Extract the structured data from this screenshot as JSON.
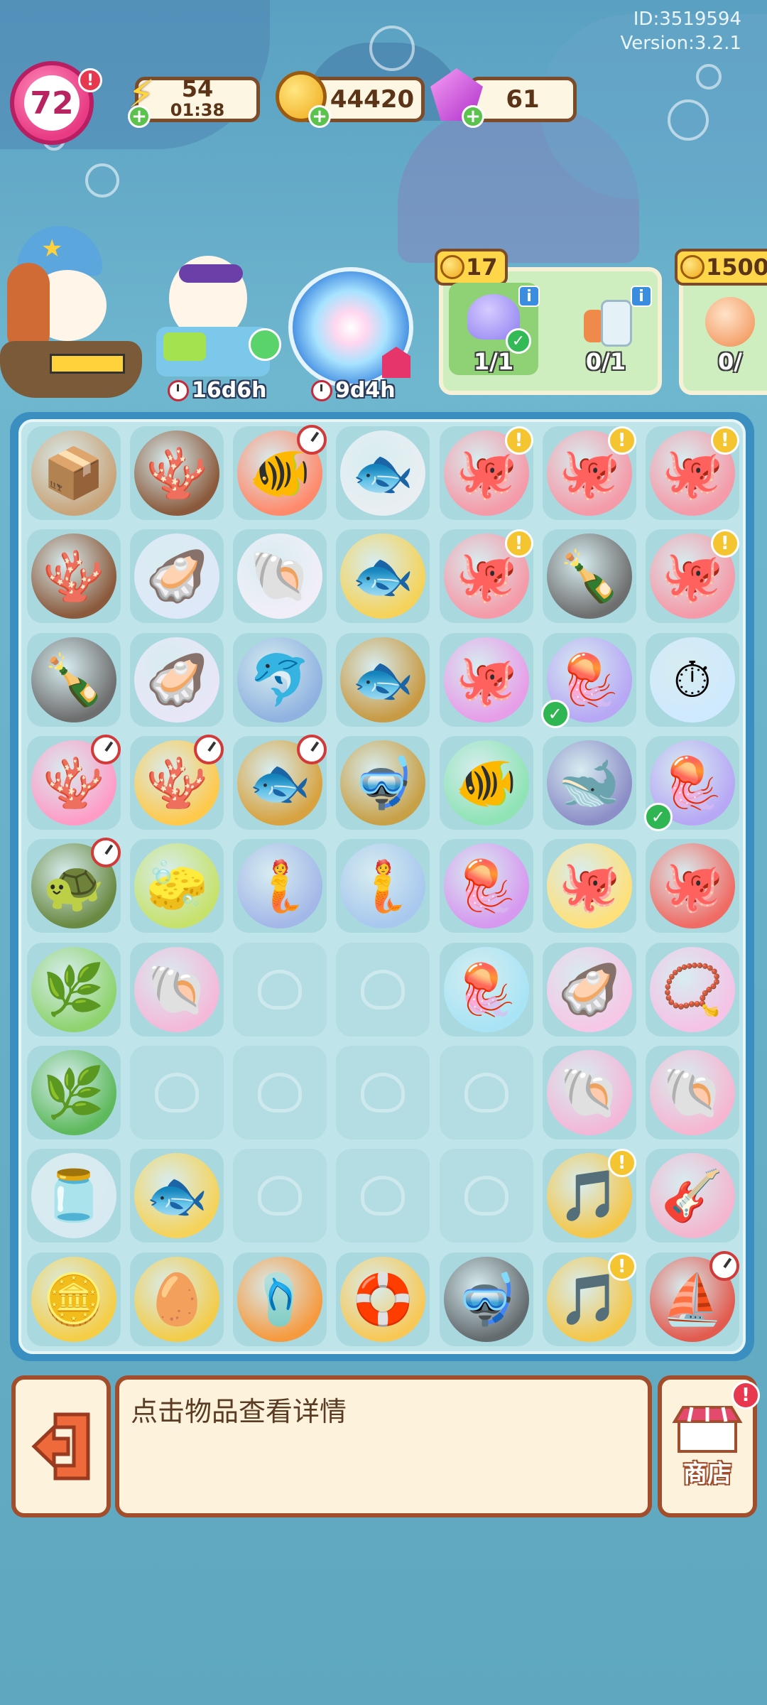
{
  "app_info": {
    "id_text": "ID:3519594",
    "version_text": "Version:3.2.1"
  },
  "player": {
    "level": "72"
  },
  "resources": {
    "energy": {
      "value": "54",
      "timer": "01:38",
      "icon": "lightning-icon"
    },
    "coins": {
      "value": "44420",
      "icon": "coin-icon"
    },
    "gems": {
      "value": "61",
      "icon": "gem-icon"
    }
  },
  "characters": [
    {
      "name": "captain-duck",
      "timer": ""
    },
    {
      "name": "sunglasses-duck",
      "timer": "16d6h"
    },
    {
      "name": "whirlpool-event",
      "timer": "9d4h"
    }
  ],
  "orders": [
    {
      "cost": "17",
      "requirements": [
        {
          "icon": "jellyfish-icon",
          "progress": "1/1",
          "done": true
        },
        {
          "icon": "bottle-coral-icon",
          "progress": "0/1",
          "done": false
        }
      ]
    },
    {
      "cost": "1500",
      "requirements": [
        {
          "icon": "mermaid-icon",
          "progress": "0/",
          "done": false
        }
      ]
    }
  ],
  "board": {
    "rows": [
      [
        "cardboard-box",
        "web-coral",
        "orange-fish-coral",
        "fish-skeleton",
        "octopus-musician",
        "octopus-musician",
        "octopus-musician"
      ],
      [
        "web-coral",
        "oyster-shell",
        "scallop-shell",
        "golden-fish-skeleton",
        "octopus-musician",
        "web-bottle",
        "octopus-musician"
      ],
      [
        "web-bottle",
        "pearl-shells",
        "dolphin",
        "bronze-fish",
        "purple-octopus",
        "jellyfish",
        "stopwatch"
      ],
      [
        "pink-coral",
        "coral-tree-worm",
        "mechanical-fish",
        "bronze-diving-helmet",
        "duck-tropical-fish",
        "captain-manta",
        "jellyfish"
      ],
      [
        "turtle-house",
        "sponge-coral",
        "mermaid-fish-heart",
        "mermaid-fish",
        "purple-jellyfish",
        "octopus-musician-glow",
        "red-octopus"
      ],
      [
        "green-sea-plant",
        "conch-shell-plant",
        "",
        "",
        "blue-jellyfish",
        "pink-pearl-oyster",
        "pearl-necklace"
      ],
      [
        "seaweed",
        "",
        "",
        "",
        "",
        "singing-conch",
        "pink-sea-snail"
      ],
      [
        "glass-dome-duck",
        "golden-fish-skeleton",
        "",
        "",
        "",
        "golden-harp",
        "pink-guitar"
      ],
      [
        "golden-nugget-pile",
        "golden-egg-nest",
        "swim-fins",
        "swim-ring",
        "scuba-tank",
        "golden-harp",
        "boat-house"
      ]
    ]
  },
  "bottom": {
    "exit_icon": "exit-icon",
    "hint": "点击物品查看详情",
    "shop_label": "商店"
  }
}
